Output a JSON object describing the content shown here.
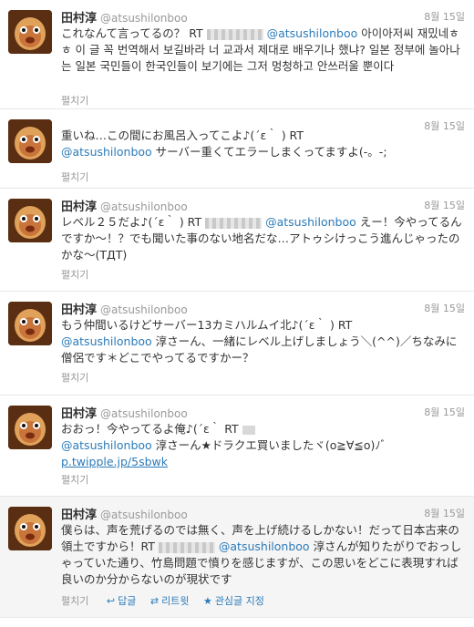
{
  "user": {
    "name": "田村淳",
    "handle": "@atsushilonboo"
  },
  "tweets": [
    {
      "time": "8월 15일",
      "p1": "これなんて言ってるの？ RT",
      "mention": "@atsushilonboo",
      "p2": "아이아저씨 재밌네ㅎㅎ 이 글 꼭 번역해서 보길바라 너 교과서 제대로 배우기나 했냐? 일본 정부에 놀아나는 일본 국민들이 한국인들이 보기에는 그저 멍청하고 안쓰러울 뿐이다",
      "expand": "펼치기"
    },
    {
      "time": "8월 15일",
      "p1": "重いね…この間にお風呂入ってこよ♪(´ε｀ ) RT",
      "mention": "@atsushilonboo",
      "p2": "サーバー重くてエラーしまくってますよ(-。-;",
      "expand": "펼치기"
    },
    {
      "time": "8월 15일",
      "p1": "レベル２５だよ♪(´ε｀ ) RT",
      "mention": "@atsushilonboo",
      "p2": "えー！今やってるんですか～！？でも聞いた事のない地名だな…アトゥシけっこう進んじゃったのかな～(TДT)",
      "expand": "펼치기"
    },
    {
      "time": "8월 15일",
      "p1": "もう仲間いるけどサーバー13カミハルムイ北♪(´ε｀ ) RT",
      "mention": "@atsushilonboo",
      "p2": "淳さーん、一緒にレベル上げしましょう＼(^^)／ちなみに僧侶です＊どこでやってるですかー？",
      "expand": "펼치기"
    },
    {
      "time": "8월 15일",
      "p1": "おおっ！今やってるよ俺♪(´ε｀ RT",
      "mention": "@atsushilonboo",
      "p2": "淳さーん★ドラクエ買いましたヾ(o≧∀≦o)ﾉﾞ",
      "link": "p.twipple.jp/5sbwk",
      "expand": "펼치기"
    },
    {
      "time": "8월 15일",
      "p1": "僕らは、声を荒げるのでは無く、声を上げ続けるしかない！だって日本古来の領土ですから！RT",
      "mention": "@atsushilonboo",
      "p2": "淳さんが知りたがりでおっしゃっていた通り、竹島問題で憤りを感じますが、この思いをどこに表現すれば良いのか分からないのが現状です",
      "expand": "펼치기",
      "actions": {
        "reply": "답글",
        "retweet": "리트윗",
        "favorite": "관심글 지정"
      }
    }
  ]
}
